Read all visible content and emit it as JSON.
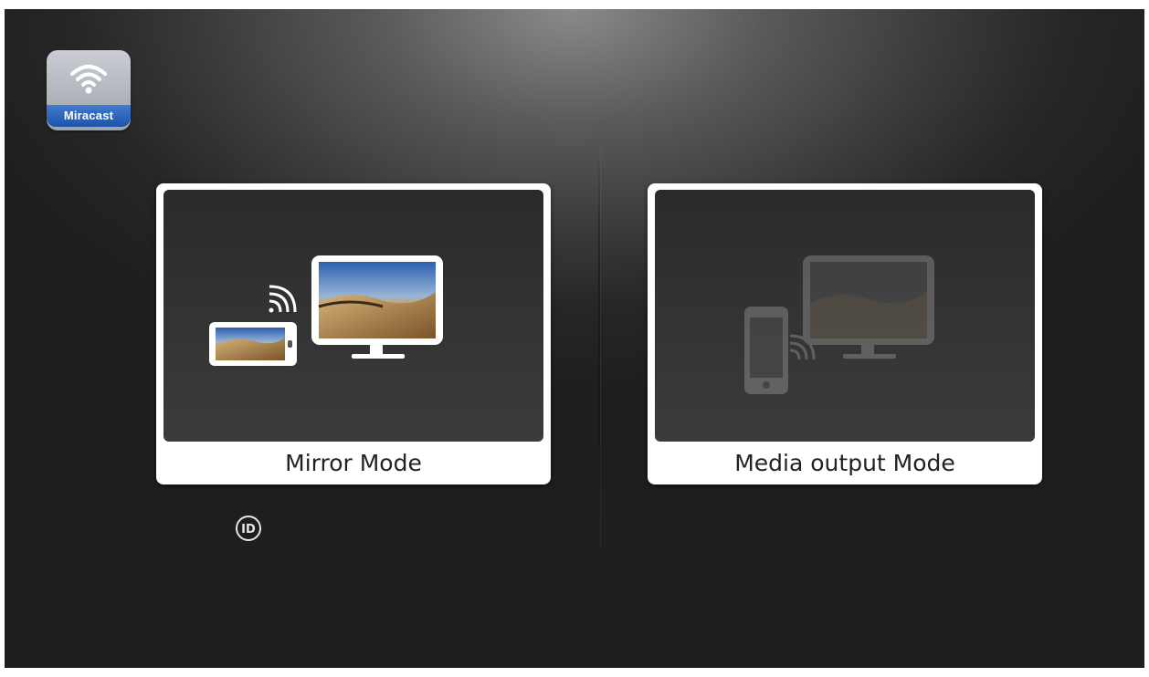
{
  "app": {
    "name": "Miracast",
    "icon": "wifi-icon"
  },
  "modes": [
    {
      "label": "Mirror Mode",
      "state": "selected"
    },
    {
      "label": "Media output Mode",
      "state": "dimmed"
    }
  ],
  "id_badge": {
    "label": "ID"
  },
  "colors": {
    "badge_blue": "#1d55a8",
    "card_white": "#ffffff",
    "background_dark": "#1e1e1e"
  }
}
